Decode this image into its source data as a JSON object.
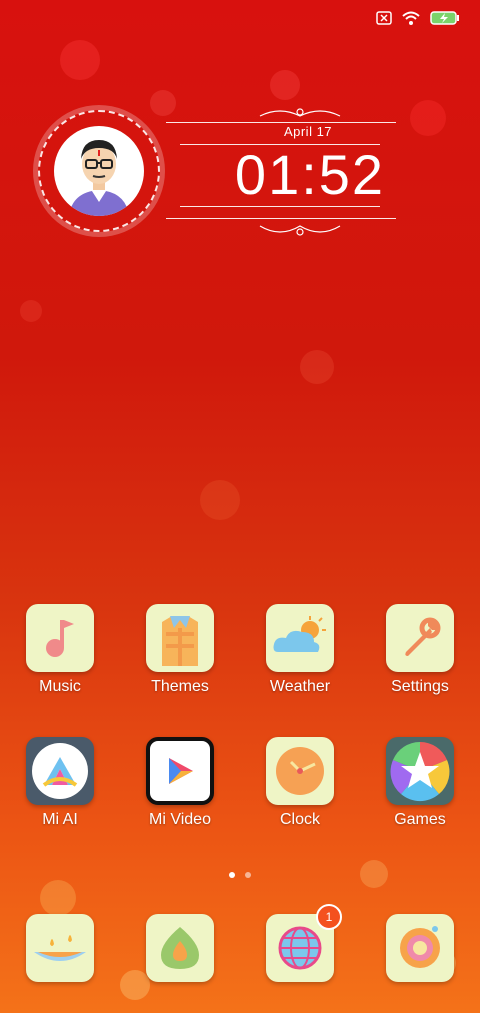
{
  "status_bar": {
    "icons": [
      "sim-x-icon",
      "wifi-icon",
      "battery-charging-icon"
    ],
    "battery_color": "#7bd36a"
  },
  "clock_widget": {
    "date": "April 17",
    "time": "01:52"
  },
  "apps_row1": [
    {
      "label": "Music",
      "icon": "music-note-icon"
    },
    {
      "label": "Themes",
      "icon": "shirt-icon"
    },
    {
      "label": "Weather",
      "icon": "cloud-sun-icon"
    },
    {
      "label": "Settings",
      "icon": "wrench-icon"
    }
  ],
  "apps_row2": [
    {
      "label": "Mi AI",
      "icon": "mi-ai-icon"
    },
    {
      "label": "Mi Video",
      "icon": "play-icon"
    },
    {
      "label": "Clock",
      "icon": "clock-icon"
    },
    {
      "label": "Games",
      "icon": "star-wheel-icon"
    }
  ],
  "dock": [
    {
      "icon": "diya-lamp-icon"
    },
    {
      "icon": "leaf-drop-icon"
    },
    {
      "icon": "globe-icon",
      "badge": "1"
    },
    {
      "icon": "camera-lens-icon"
    }
  ],
  "page_indicator": {
    "pages": 2,
    "current": 1
  },
  "colors": {
    "icon_background": "#eff5c6",
    "badge": "#f4511e"
  }
}
